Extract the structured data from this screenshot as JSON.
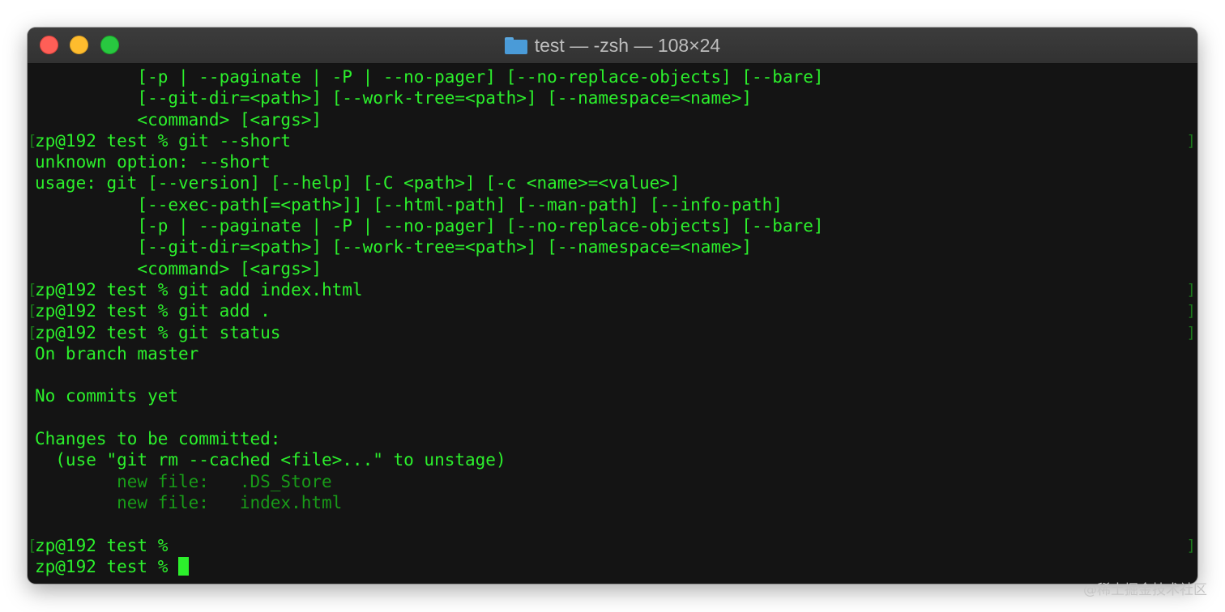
{
  "window": {
    "title": "test — -zsh — 108×24"
  },
  "terminal": {
    "lines": [
      {
        "text": "          [-p | --paginate | -P | --no-pager] [--no-replace-objects] [--bare]",
        "prompt": false,
        "dim": false
      },
      {
        "text": "          [--git-dir=<path>] [--work-tree=<path>] [--namespace=<name>]",
        "prompt": false,
        "dim": false
      },
      {
        "text": "          <command> [<args>]",
        "prompt": false,
        "dim": false
      },
      {
        "text": "zp@192 test % git --short",
        "prompt": true,
        "dim": false
      },
      {
        "text": "unknown option: --short",
        "prompt": false,
        "dim": false
      },
      {
        "text": "usage: git [--version] [--help] [-C <path>] [-c <name>=<value>]",
        "prompt": false,
        "dim": false
      },
      {
        "text": "          [--exec-path[=<path>]] [--html-path] [--man-path] [--info-path]",
        "prompt": false,
        "dim": false
      },
      {
        "text": "          [-p | --paginate | -P | --no-pager] [--no-replace-objects] [--bare]",
        "prompt": false,
        "dim": false
      },
      {
        "text": "          [--git-dir=<path>] [--work-tree=<path>] [--namespace=<name>]",
        "prompt": false,
        "dim": false
      },
      {
        "text": "          <command> [<args>]",
        "prompt": false,
        "dim": false
      },
      {
        "text": "zp@192 test % git add index.html",
        "prompt": true,
        "dim": false
      },
      {
        "text": "zp@192 test % git add .",
        "prompt": true,
        "dim": false
      },
      {
        "text": "zp@192 test % git status",
        "prompt": true,
        "dim": false
      },
      {
        "text": "On branch master",
        "prompt": false,
        "dim": false
      },
      {
        "text": "",
        "prompt": false,
        "dim": false
      },
      {
        "text": "No commits yet",
        "prompt": false,
        "dim": false
      },
      {
        "text": "",
        "prompt": false,
        "dim": false
      },
      {
        "text": "Changes to be committed:",
        "prompt": false,
        "dim": false
      },
      {
        "text": "  (use \"git rm --cached <file>...\" to unstage)",
        "prompt": false,
        "dim": false
      },
      {
        "text": "        new file:   .DS_Store",
        "prompt": false,
        "dim": true
      },
      {
        "text": "        new file:   index.html",
        "prompt": false,
        "dim": true
      },
      {
        "text": "",
        "prompt": false,
        "dim": false
      },
      {
        "text": "zp@192 test % ",
        "prompt": true,
        "dim": false
      }
    ],
    "active_prompt": "zp@192 test % "
  },
  "bracket_left": "[",
  "bracket_right": "]",
  "watermark": "@稀土掘金技术社区"
}
